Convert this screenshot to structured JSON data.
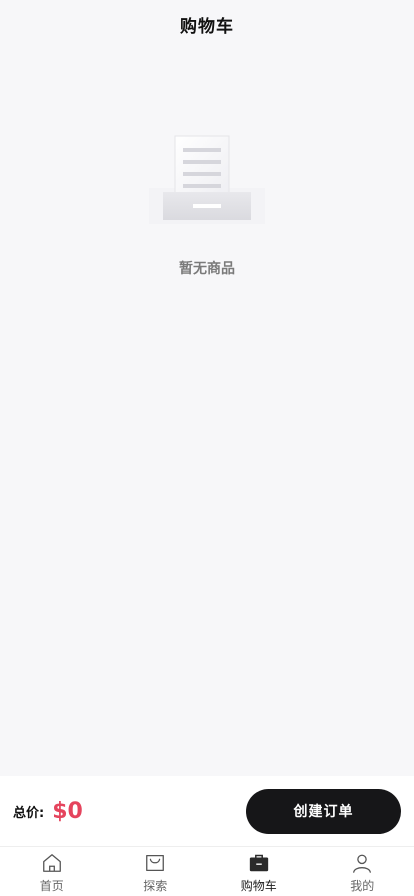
{
  "header": {
    "title": "购物车"
  },
  "empty_state": {
    "message": "暂无商品",
    "icon": "empty-tray-document-icon"
  },
  "checkout": {
    "total_label": "总价:",
    "total_value": "$0",
    "create_order_label": "创建订单",
    "accent_color": "#e5445d"
  },
  "tabbar": {
    "active": "cart",
    "items": [
      {
        "key": "home",
        "label": "首页",
        "icon": "home-icon"
      },
      {
        "key": "explore",
        "label": "探索",
        "icon": "shopping-bag-icon"
      },
      {
        "key": "cart",
        "label": "购物车",
        "icon": "briefcase-icon"
      },
      {
        "key": "me",
        "label": "我的",
        "icon": "user-icon"
      }
    ]
  }
}
